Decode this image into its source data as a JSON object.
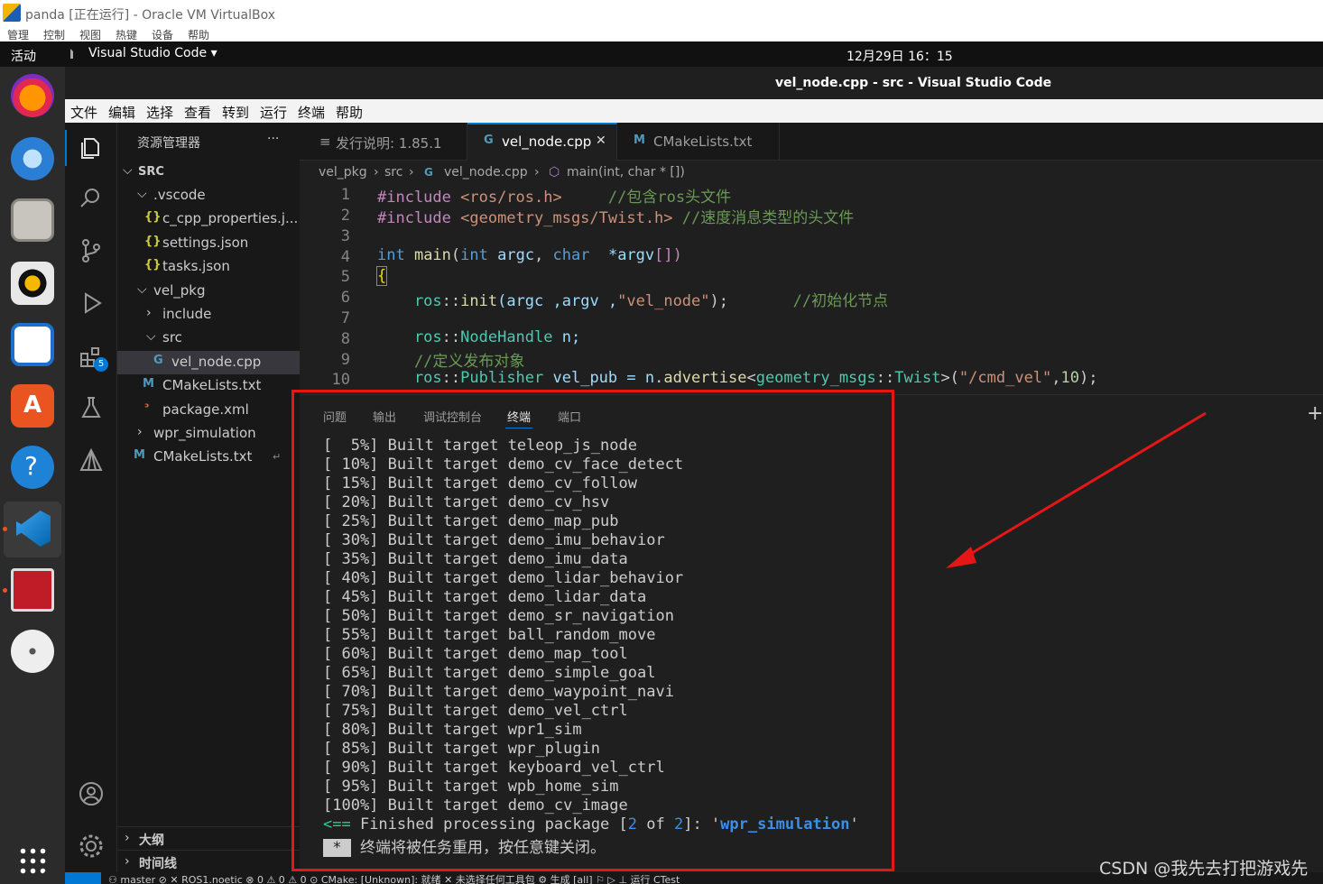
{
  "vbox": {
    "title": "panda [正在运行] - Oracle VM VirtualBox",
    "menu": [
      "管理",
      "控制",
      "视图",
      "热键",
      "设备",
      "帮助"
    ]
  },
  "gnome": {
    "activities": "活动",
    "app_name": "Visual Studio Code ▾",
    "clock": "12月29日  16：15"
  },
  "window_title": "vel_node.cpp - src - Visual Studio Code",
  "menu": [
    "文件",
    "编辑",
    "选择",
    "查看",
    "转到",
    "运行",
    "终端",
    "帮助"
  ],
  "sidebar": {
    "title": "资源管理器",
    "more": "···",
    "root": "SRC",
    "items": [
      {
        "label": ".vscode",
        "kind": "folder-open"
      },
      {
        "label": "c_cpp_properties.j...",
        "kind": "json"
      },
      {
        "label": "settings.json",
        "kind": "json"
      },
      {
        "label": "tasks.json",
        "kind": "json"
      },
      {
        "label": "vel_pkg",
        "kind": "folder-open"
      },
      {
        "label": "include",
        "kind": "folder-closed"
      },
      {
        "label": "src",
        "kind": "folder-open"
      },
      {
        "label": "vel_node.cpp",
        "kind": "cpp"
      },
      {
        "label": "CMakeLists.txt",
        "kind": "cmake"
      },
      {
        "label": "package.xml",
        "kind": "xml"
      },
      {
        "label": "wpr_simulation",
        "kind": "folder-closed"
      },
      {
        "label": "CMakeLists.txt",
        "kind": "cmake"
      }
    ],
    "outline": "大纲",
    "timeline": "时间线"
  },
  "tabs": [
    {
      "label": "发行说明: 1.85.1",
      "icon": "≡"
    },
    {
      "label": "vel_node.cpp",
      "icon": "G"
    },
    {
      "label": "CMakeLists.txt",
      "icon": "M"
    }
  ],
  "close_glyph": "✕",
  "breadcrumb": [
    "vel_pkg",
    "src",
    "vel_node.cpp",
    "main(int, char * [])"
  ],
  "line_numbers": [
    "1",
    "2",
    "3",
    "4",
    "5",
    "6",
    "7",
    "8",
    "9",
    "10"
  ],
  "code": {
    "l1a": "#include ",
    "l1b": "<ros/ros.h>",
    "l1c": "     //包含ros头文件",
    "l2a": "#include ",
    "l2b": "<geometry_msgs/Twist.h>",
    "l2c": " //速度消息类型的头文件",
    "l4a": "int",
    "l4b": " main",
    "l4c": "(",
    "l4d": "int",
    "l4e": " argc",
    "l4f": ", ",
    "l4g": "char",
    "l4h": "  *argv",
    "l4i": "[])",
    "l5": "{",
    "l6a": "    ros",
    "l6b": "::",
    "l6c": "init",
    "l6d": "(argc ,argv ,",
    "l6e": "\"vel_node\"",
    "l6f": ");",
    "l6g": "       //初始化节点",
    "l8a": "    ros",
    "l8b": "::",
    "l8c": "NodeHandle",
    "l8d": " n;",
    "l9": "    //定义发布对象",
    "l10a": "    ros",
    "l10b": "::",
    "l10c": "Publisher",
    "l10d": " vel_pub = n.",
    "l10e": "advertise",
    "l10f": "<",
    "l10g": "geometry_msgs",
    "l10h": "::",
    "l10i": "Twist",
    "l10j": ">(",
    "l10k": "\"/cmd_vel\"",
    "l10l": ",",
    "l10m": "10",
    "l10n": ");"
  },
  "panel_tabs": [
    "问题",
    "输出",
    "调试控制台",
    "终端",
    "端口"
  ],
  "panel_plus": "+",
  "terminal": [
    "[  5%] Built target teleop_js_node",
    "[ 10%] Built target demo_cv_face_detect",
    "[ 15%] Built target demo_cv_follow",
    "[ 20%] Built target demo_cv_hsv",
    "[ 25%] Built target demo_map_pub",
    "[ 30%] Built target demo_imu_behavior",
    "[ 35%] Built target demo_imu_data",
    "[ 40%] Built target demo_lidar_behavior",
    "[ 45%] Built target demo_lidar_data",
    "[ 50%] Built target demo_sr_navigation",
    "[ 55%] Built target ball_random_move",
    "[ 60%] Built target demo_map_tool",
    "[ 65%] Built target demo_simple_goal",
    "[ 70%] Built target demo_waypoint_navi",
    "[ 75%] Built target demo_vel_ctrl",
    "[ 80%] Built target wpr1_sim",
    "[ 85%] Built target wpr_plugin",
    "[ 90%] Built target keyboard_vel_ctrl",
    "[ 95%] Built target wpb_home_sim",
    "[100%] Built target demo_cv_image"
  ],
  "finish": {
    "arrow": "<==",
    "text1": " Finished processing package [",
    "n1": "2",
    "of": " of ",
    "n2": "2",
    "text2": "]: '",
    "pkg": "wpr_simulation",
    "text3": "'"
  },
  "reuse": {
    "marker": " * ",
    "text": " 终端将被任务重用，按任意键关闭。"
  },
  "status": "⚇ master ⊘   ✕ ROS1.noetic   ⊗ 0 ⚠ 0   ⚠ 0   ⊙ CMake: [Unknown]: 就绪   ✕ 未选择任何工具包   ⚙ 生成   [all]   ⚐   ▷   ⊥ 运行 CTest",
  "watermark": "CSDN @我先去打把游戏先",
  "colors": {
    "annotation_red": "#e51616",
    "vscode_blue": "#0078d4",
    "accent_orange": "#e95420"
  }
}
